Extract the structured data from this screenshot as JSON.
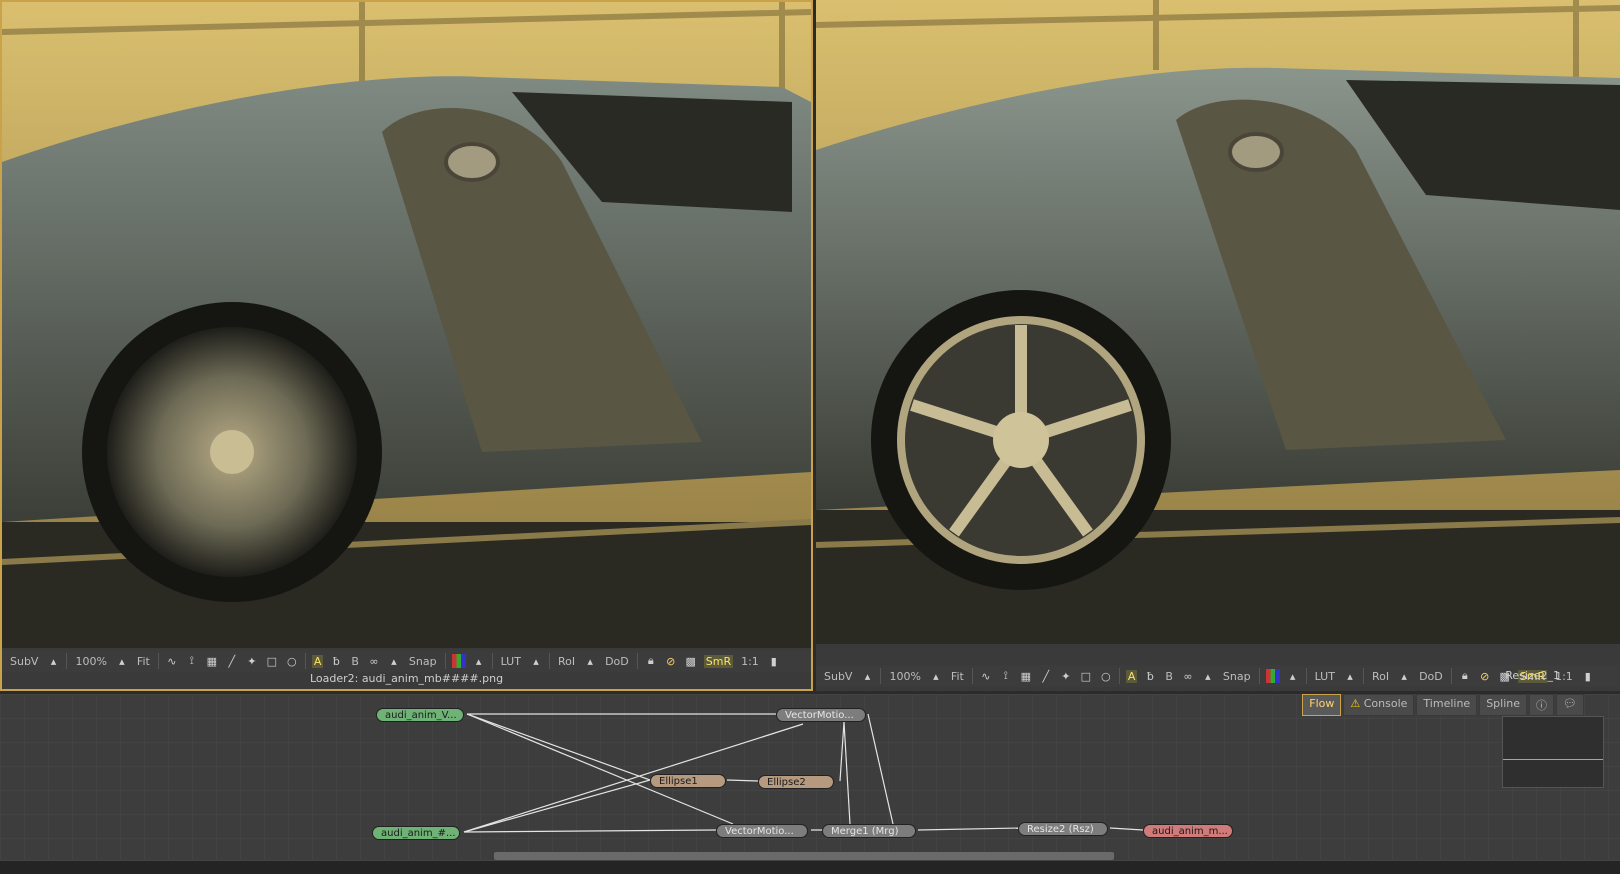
{
  "left_viewer": {
    "toolbar": {
      "subv": "SubV",
      "zoom": "100%",
      "fit": "Fit",
      "snap": "Snap",
      "lut": "LUT",
      "roi": "RoI",
      "dod": "DoD",
      "smr": "SmR",
      "ratio": "1:1",
      "a_btn": "A",
      "b_btn": "B"
    },
    "caption": "Loader2: audi_anim_mb####.png"
  },
  "right_viewer": {
    "toolbar": {
      "subv": "SubV",
      "zoom": "100%",
      "fit": "Fit",
      "snap": "Snap",
      "lut": "LUT",
      "roi": "RoI",
      "dod": "DoD",
      "smr": "SmR",
      "ratio": "1:1",
      "a_btn": "A",
      "b_btn": "B"
    },
    "node_name": "Resize2_1"
  },
  "flow": {
    "tabs": [
      "Flow",
      "Console",
      "Timeline",
      "Spline"
    ],
    "nodes": {
      "loader_v": "audi_anim_V...",
      "loader_main": "audi_anim_#...",
      "vector_top": "VectorMotio...",
      "vector_bottom": "VectorMotio...",
      "ellipse1": "Ellipse1",
      "ellipse2": "Ellipse2",
      "merge1": "Merge1 (Mrg)",
      "resize2": "Resize2 (Rsz)",
      "saver": "audi_anim_m..."
    }
  },
  "colors": {
    "accent": "#c9a24a",
    "loader": "#6fb276",
    "mask": "#b59a80",
    "saver": "#d07a7a"
  }
}
